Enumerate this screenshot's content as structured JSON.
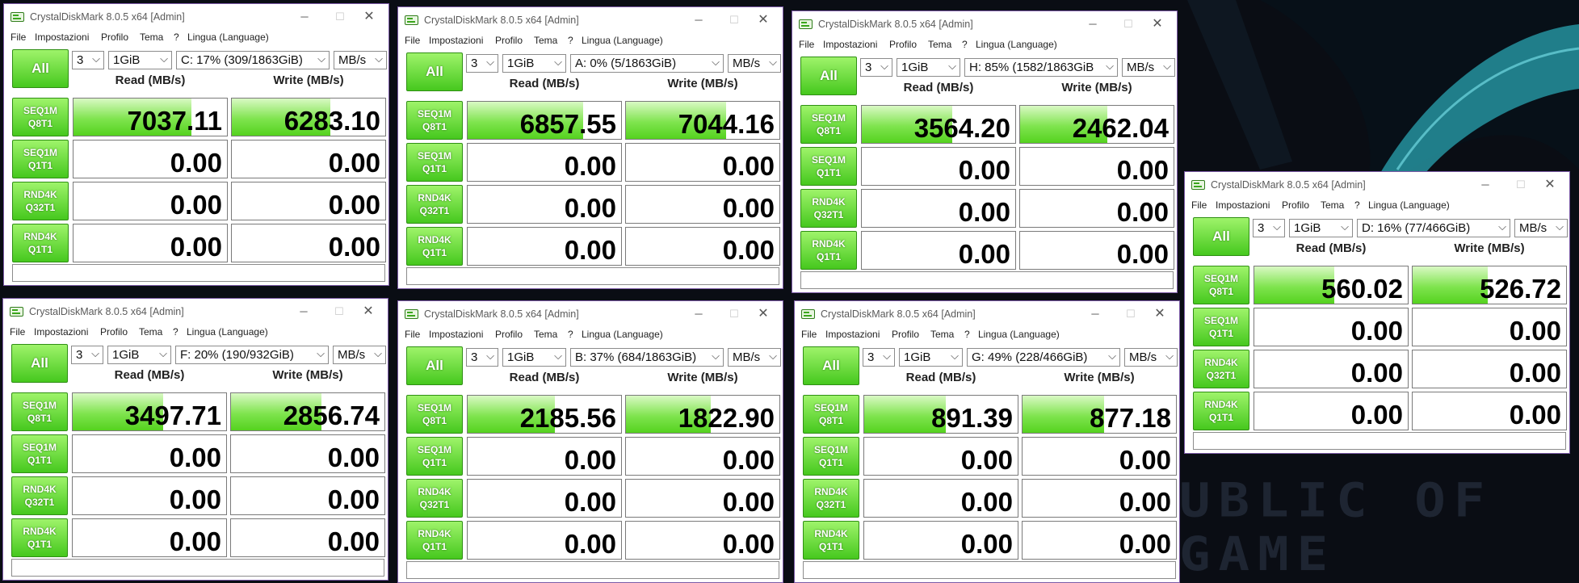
{
  "app_title": "CrystalDiskMark 8.0.5 x64 [Admin]",
  "colors": {
    "accent_green": "#46c81e",
    "bar_green": "#7fe44e",
    "window_border": "#7b5aa6"
  },
  "menu": [
    "File",
    "Impostazioni",
    "Profilo",
    "Tema",
    "?",
    "Lingua (Language)"
  ],
  "labels": {
    "all": "All",
    "read_header": "Read (MB/s)",
    "write_header": "Write (MB/s)",
    "dropdown_arrow": "⌵",
    "minimize": "─",
    "maximize": "☐",
    "close": "✕"
  },
  "tests": [
    {
      "l1": "SEQ1M",
      "l2": "Q8T1"
    },
    {
      "l1": "SEQ1M",
      "l2": "Q1T1"
    },
    {
      "l1": "RND4K",
      "l2": "Q32T1"
    },
    {
      "l1": "RND4K",
      "l2": "Q1T1"
    }
  ],
  "windows": [
    {
      "count": "3",
      "size": "1GiB",
      "drive": "C: 17% (309/1863GiB)",
      "unit": "MB/s",
      "read": [
        "7037.11",
        "0.00",
        "0.00",
        "0.00"
      ],
      "write": [
        "6283.10",
        "0.00",
        "0.00",
        "0.00"
      ],
      "read_fill": 0.77,
      "write_fill": 0.64
    },
    {
      "count": "3",
      "size": "1GiB",
      "drive": "A: 0% (5/1863GiB)",
      "unit": "MB/s",
      "read": [
        "6857.55",
        "0.00",
        "0.00",
        "0.00"
      ],
      "write": [
        "7044.16",
        "0.00",
        "0.00",
        "0.00"
      ],
      "read_fill": 0.75,
      "write_fill": 0.65
    },
    {
      "count": "3",
      "size": "1GiB",
      "drive": "H: 85% (1582/1863GiB",
      "unit": "MB/s",
      "read": [
        "3564.20",
        "0.00",
        "0.00",
        "0.00"
      ],
      "write": [
        "2462.04",
        "0.00",
        "0.00",
        "0.00"
      ],
      "read_fill": 0.59,
      "write_fill": 0.57
    },
    {
      "count": "3",
      "size": "1GiB",
      "drive": "D: 16% (77/466GiB)",
      "unit": "MB/s",
      "read": [
        "560.02",
        "0.00",
        "0.00",
        "0.00"
      ],
      "write": [
        "526.72",
        "0.00",
        "0.00",
        "0.00"
      ],
      "read_fill": 0.52,
      "write_fill": 0.49
    },
    {
      "count": "3",
      "size": "1GiB",
      "drive": "F: 20% (190/932GiB)",
      "unit": "MB/s",
      "read": [
        "3497.71",
        "0.00",
        "0.00",
        "0.00"
      ],
      "write": [
        "2856.74",
        "0.00",
        "0.00",
        "0.00"
      ],
      "read_fill": 0.59,
      "write_fill": 0.59
    },
    {
      "count": "3",
      "size": "1GiB",
      "drive": "B: 37% (684/1863GiB)",
      "unit": "MB/s",
      "read": [
        "2185.56",
        "0.00",
        "0.00",
        "0.00"
      ],
      "write": [
        "1822.90",
        "0.00",
        "0.00",
        "0.00"
      ],
      "read_fill": 0.57,
      "write_fill": 0.55
    },
    {
      "count": "3",
      "size": "1GiB",
      "drive": "G: 49% (228/466GiB)",
      "unit": "MB/s",
      "read": [
        "891.39",
        "0.00",
        "0.00",
        "0.00"
      ],
      "write": [
        "877.18",
        "0.00",
        "0.00",
        "0.00"
      ],
      "read_fill": 0.53,
      "write_fill": 0.53
    }
  ]
}
